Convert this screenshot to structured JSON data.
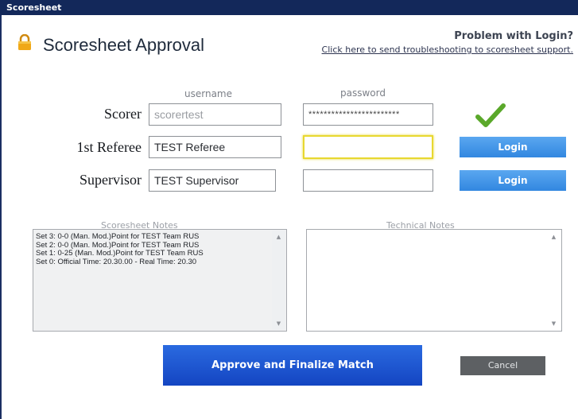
{
  "window": {
    "title": "Scoresheet"
  },
  "header": {
    "heading": "Scoresheet Approval",
    "problem_text": "Problem with Login?",
    "support_link": "Click here to send troubleshooting to scoresheet support."
  },
  "columns": {
    "username": "username",
    "password": "password"
  },
  "rows": [
    {
      "label": "Scorer",
      "username": "scorertest",
      "password": "************************",
      "status": "check-icon"
    },
    {
      "label": "1st Referee",
      "username": "TEST Referee",
      "password": "",
      "button": "Login"
    },
    {
      "label": "Supervisor",
      "username": "TEST Supervisor",
      "password": "",
      "button": "Login"
    }
  ],
  "notes": {
    "scoresheet_label": "Scoresheet Notes",
    "technical_label": "Technical Notes",
    "scoresheet_lines": [
      "Set 3: 0-0 (Man. Mod.)Point for TEST Team RUS",
      "Set 2: 0-0 (Man. Mod.)Point for TEST Team RUS",
      "Set 1: 0-25 (Man. Mod.)Point for TEST Team RUS",
      "Set 0: Official Time:  20.30.00  -  Real Time:  20.30"
    ]
  },
  "actions": {
    "approve": "Approve and Finalize Match",
    "cancel": "Cancel"
  },
  "colors": {
    "titlebar": "#13285a",
    "login": "#3b8de3",
    "approve": "#1e55d0",
    "cancel": "#5d6063",
    "check": "#5aa82a",
    "focus": "#e8d830"
  }
}
